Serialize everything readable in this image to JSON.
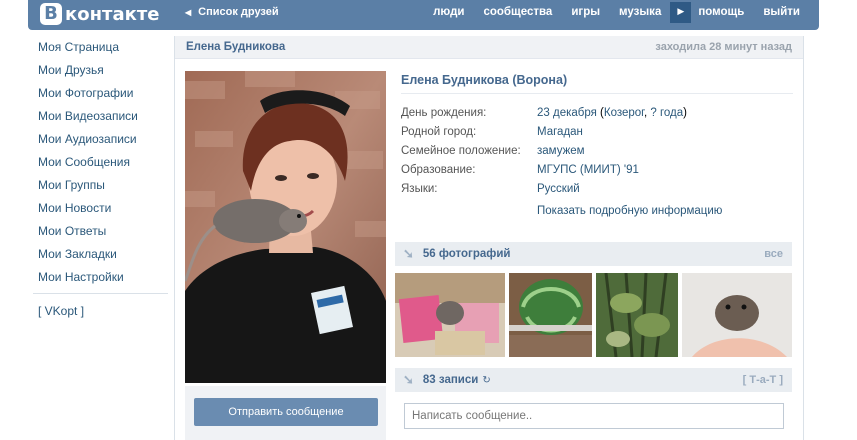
{
  "header": {
    "logo_mark": "B",
    "logo_text": "контакте",
    "back_label": "Список друзей",
    "nav": [
      "люди",
      "сообщества",
      "игры",
      "музыка"
    ],
    "help": "помощь",
    "exit": "выйти",
    "bg_color": "#5b7fa6"
  },
  "menu": {
    "items": [
      "Моя Страница",
      "Мои Друзья",
      "Мои Фотографии",
      "Мои Видеозаписи",
      "Мои Аудиозаписи",
      "Мои Сообщения",
      "Мои Группы",
      "Мои Новости",
      "Мои Ответы",
      "Мои Закладки",
      "Мои Настройки"
    ],
    "extra": "[ VKopt ]"
  },
  "profile": {
    "header_name": "Елена Будникова",
    "last_seen": "заходила 28 минут назад",
    "full_name": "Елена Будникова (Ворона)",
    "birthday_label": "День рождения:",
    "birthday_date": "23 декабря",
    "birthday_paren_open": " (",
    "zodiac": "Козерог",
    "comma": ", ",
    "year": "? года",
    "paren_close": ")",
    "hometown_label": "Родной город:",
    "hometown": "Магадан",
    "status_label": "Семейное положение:",
    "status": "замужем",
    "education_label": "Образование:",
    "education": "МГУПС (МИИТ) '91",
    "languages_label": "Языки:",
    "languages": "Русский",
    "show_more": "Показать подробную информацию",
    "send_message": "Отправить сообщение"
  },
  "photos_block": {
    "title": "56 фотографий",
    "all_link": "все"
  },
  "wall_block": {
    "title": "83 записи",
    "right_label": "[ Т-а-Т ]",
    "placeholder": "Написать сообщение.."
  }
}
